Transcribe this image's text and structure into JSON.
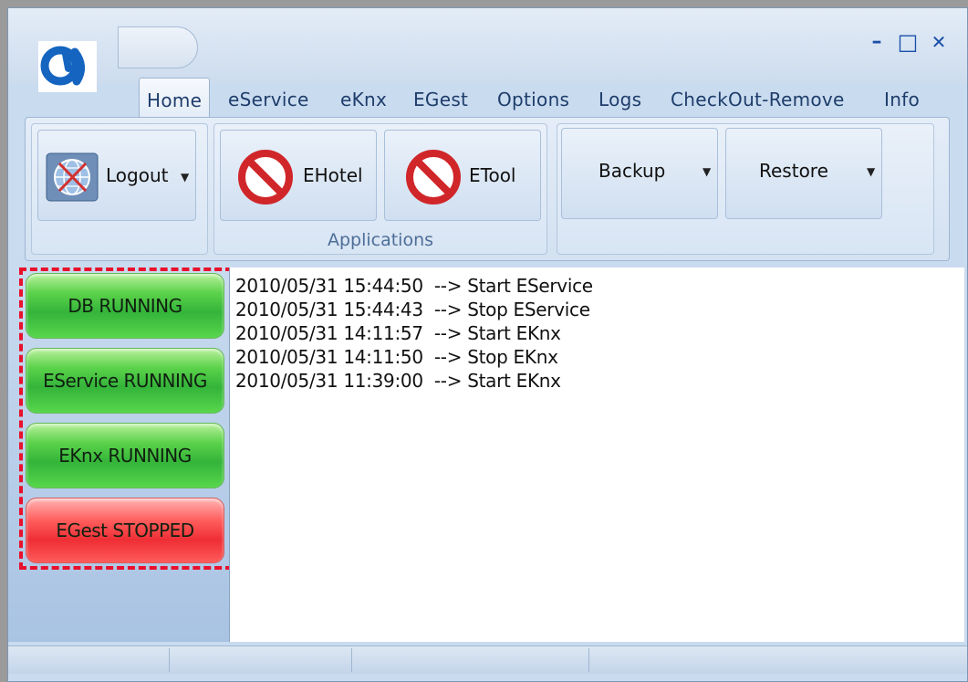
{
  "window": {
    "minimize_glyph": "–",
    "maximize_glyph": "□",
    "close_glyph": "✕"
  },
  "tabs": [
    "Home",
    "eService",
    "eKnx",
    "EGest",
    "Options",
    "Logs",
    "CheckOut-Remove",
    "Info"
  ],
  "ribbon": {
    "logout_label": "Logout",
    "ehotel_label": "EHotel",
    "etool_label": "ETool",
    "applications_group_label": "Applications",
    "backup_label": "Backup",
    "restore_label": "Restore",
    "dropdown_glyph": "▼"
  },
  "services": [
    {
      "label": "DB RUNNING",
      "state": "running",
      "color": "#3cbf3c"
    },
    {
      "label": "EService RUNNING",
      "state": "running",
      "color": "#3cbf3c"
    },
    {
      "label": "EKnx RUNNING",
      "state": "running",
      "color": "#3cbf3c"
    },
    {
      "label": "EGest STOPPED",
      "state": "stopped",
      "color": "#f03a3a"
    }
  ],
  "log": [
    "2010/05/31 15:44:50  --> Start EService",
    "2010/05/31 15:44:43  --> Stop EService",
    "2010/05/31 14:11:57  --> Start EKnx",
    "2010/05/31 14:11:50  --> Stop EKnx",
    "2010/05/31 11:39:00  --> Start EKnx"
  ],
  "colors": {
    "highlight_dash": "#e8102c",
    "tab_text": "#1e3d6b",
    "group_label": "#4d6e98"
  },
  "icons": {
    "app_logo": "app-logo-icon",
    "logout": "network-globe-icon",
    "ehotel": "prohibited-icon",
    "etool": "prohibited-icon"
  }
}
